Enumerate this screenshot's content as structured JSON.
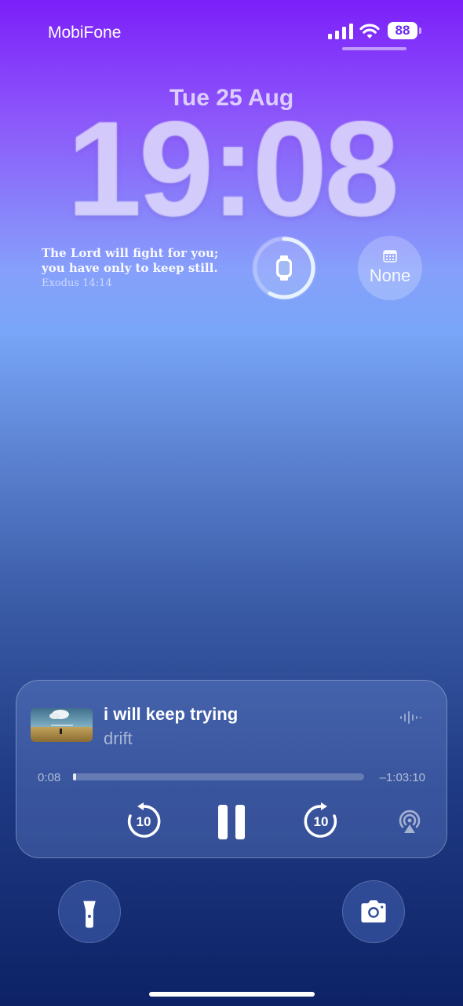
{
  "status_bar": {
    "carrier": "MobiFone",
    "battery_percent": "88",
    "signal_icon": "cellular-signal-icon",
    "wifi_icon": "wifi-icon"
  },
  "lock_screen": {
    "date": "Tue 25 Aug",
    "time": "19:08"
  },
  "widgets": {
    "verse": {
      "line1": "The Lord will fight for you;",
      "line2": "you have only to keep still.",
      "reference": "Exodus 14:14"
    },
    "watch_battery": {
      "icon": "apple-watch-icon",
      "progress_fraction": 0.58
    },
    "calendar": {
      "icon": "calendar-icon",
      "label": "None"
    }
  },
  "now_playing": {
    "title": "i will keep trying",
    "artist": "drift",
    "elapsed": "0:08",
    "remaining": "–1:03:10",
    "progress_fraction": 0.005,
    "skip_back_seconds": "10",
    "skip_forward_seconds": "10",
    "icons": [
      "waveform-icon",
      "skip-back-icon",
      "pause-icon",
      "skip-forward-icon",
      "airplay-icon"
    ]
  },
  "bottom_controls": {
    "left_icon": "flashlight-icon",
    "right_icon": "camera-icon"
  },
  "colors": {
    "gradient_top": "#7c1ff9",
    "gradient_mid": "#79a6f8",
    "gradient_bottom": "#0d2266",
    "battery_text": "#6a2df5"
  }
}
